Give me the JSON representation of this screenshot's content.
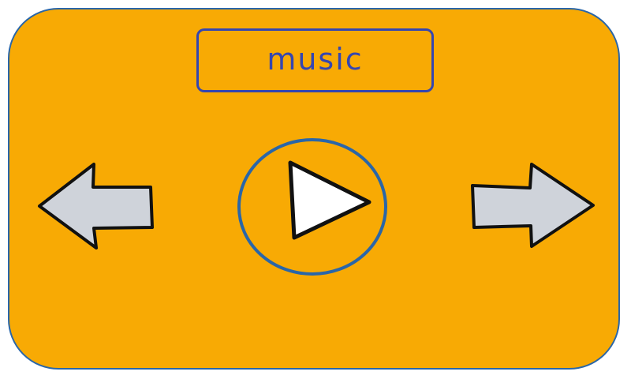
{
  "player": {
    "title": "music"
  },
  "icons": {
    "previous": "arrow-left-icon",
    "play": "play-icon",
    "next": "arrow-right-icon"
  },
  "colors": {
    "panel_fill": "#f8aa04",
    "panel_border": "#2a66a8",
    "title_border": "#3546b0",
    "title_text": "#3546b0",
    "arrow_fill": "#cfd3da",
    "play_ring": "#2a66a8",
    "play_fill": "#ffffff",
    "outline": "#111111"
  }
}
